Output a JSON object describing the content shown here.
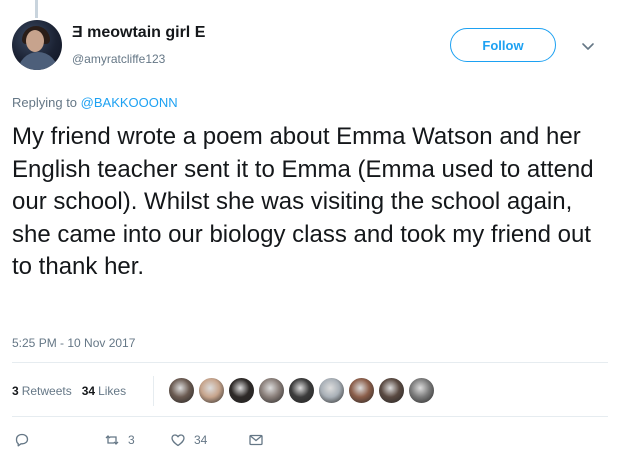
{
  "user": {
    "display_name": "Ǝ meowtain girl E",
    "handle": "@amyratcliffe123"
  },
  "follow_label": "Follow",
  "reply": {
    "prefix": "Replying to",
    "to": "@BAKKOOONN"
  },
  "tweet_text": "My friend wrote a poem about Emma Watson and her English teacher sent it to Emma (Emma used to attend our school). Whilst she was visiting the school again, she came into our biology class and took my friend out to thank her.",
  "timestamp": "5:25 PM - 10 Nov 2017",
  "stats": {
    "retweets_count": "3",
    "retweets_label": "Retweets",
    "likes_count": "34",
    "likes_label": "Likes"
  },
  "actions": {
    "reply_count": "",
    "retweet_count": "3",
    "like_count": "34"
  },
  "liker_colors": [
    "#6b5b52",
    "#c6a48c",
    "#2e2a28",
    "#8a7f7a",
    "#3c3c3c",
    "#a9b0b7",
    "#8b5e4a",
    "#5a4a42",
    "#7b7b7b"
  ],
  "colors": {
    "accent": "#1da1f2",
    "muted": "#657786",
    "text": "#14171a"
  }
}
